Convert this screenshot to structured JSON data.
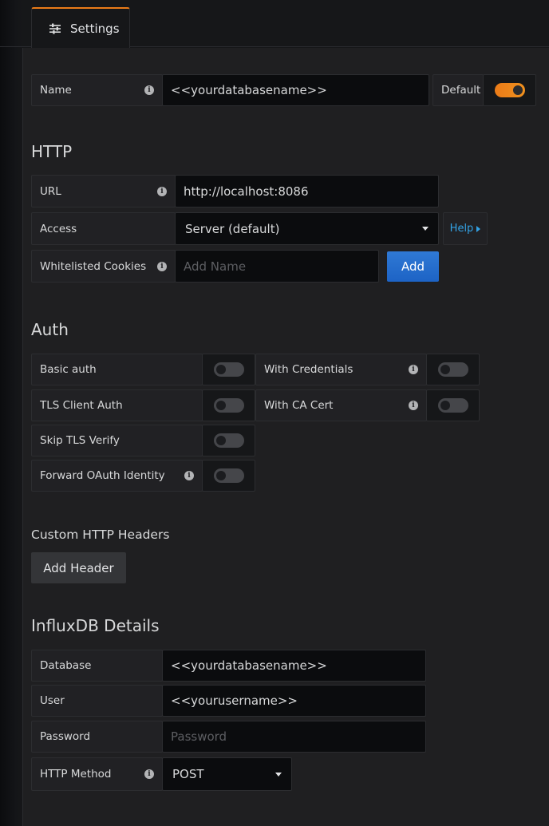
{
  "tab": {
    "label": "Settings",
    "icon": "sliders-icon"
  },
  "name_row": {
    "label": "Name",
    "value": "<<yourdatabasename>>",
    "default_label": "Default",
    "default_on": true
  },
  "http": {
    "title": "HTTP",
    "url_label": "URL",
    "url_value": "http://localhost:8086",
    "access_label": "Access",
    "access_value": "Server (default)",
    "help_label": "Help",
    "cookies_label": "Whitelisted Cookies",
    "cookies_placeholder": "Add Name",
    "add_label": "Add"
  },
  "auth": {
    "title": "Auth",
    "basic_auth": "Basic auth",
    "with_credentials": "With Credentials",
    "tls_client_auth": "TLS Client Auth",
    "with_ca_cert": "With CA Cert",
    "skip_tls_verify": "Skip TLS Verify",
    "forward_oauth": "Forward OAuth Identity"
  },
  "headers": {
    "title": "Custom HTTP Headers",
    "add_label": "Add Header"
  },
  "influx": {
    "title": "InfluxDB Details",
    "database_label": "Database",
    "database_value": "<<yourdatabasename>>",
    "user_label": "User",
    "user_value": "<<yourusername>>",
    "password_label": "Password",
    "password_placeholder": "Password",
    "method_label": "HTTP Method",
    "method_value": "POST"
  },
  "colors": {
    "accent": "#eb7b18",
    "primary": "#1d63c5",
    "link": "#33a2e5"
  }
}
